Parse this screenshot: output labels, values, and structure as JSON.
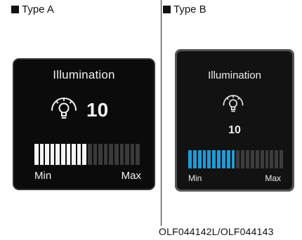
{
  "type_a": {
    "heading": "Type A",
    "title": "Illumination",
    "value": "10",
    "icon": "illumination-bulb-icon",
    "level": 10,
    "segments_total": 20,
    "min_label": "Min",
    "max_label": "Max",
    "colors": {
      "filled": "#f5f5f5",
      "empty": "#3a3a3a",
      "background": "#0b0b0b"
    }
  },
  "type_b": {
    "heading": "Type B",
    "title": "Illumination",
    "value": "10",
    "icon": "illumination-bulb-icon",
    "level": 10,
    "segments_total": 20,
    "min_label": "Min",
    "max_label": "Max",
    "colors": {
      "filled": "#1f9ad6",
      "empty": "#3c3c3c",
      "background": "#121212"
    }
  },
  "footer": {
    "code": "OLF044142L/OLF044143"
  }
}
